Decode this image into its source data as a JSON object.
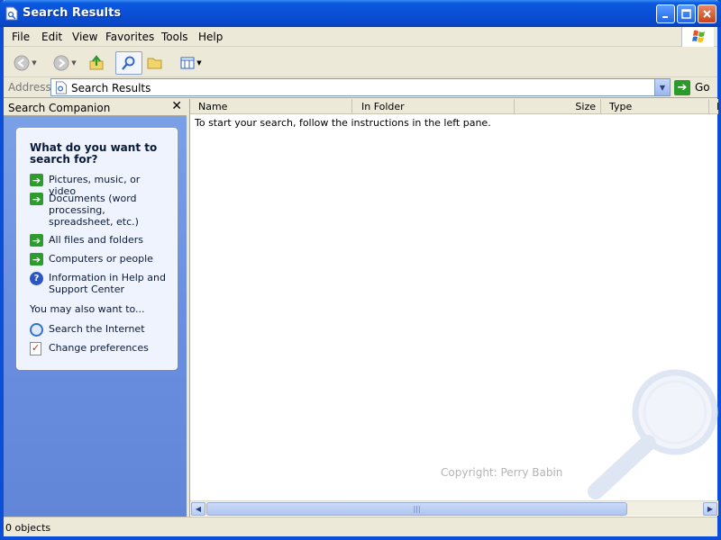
{
  "window": {
    "title": "Search Results"
  },
  "menu": [
    "File",
    "Edit",
    "View",
    "Favorites",
    "Tools",
    "Help"
  ],
  "address": {
    "label": "Address",
    "value": "Search Results",
    "go_label": "Go"
  },
  "search_companion": {
    "title": "Search Companion",
    "close_glyph": "✕",
    "heading": "What do you want to search for?",
    "options": [
      {
        "label": "Pictures, music, or video",
        "icon": "green-arrow-icon"
      },
      {
        "label": "Documents (word processing, spreadsheet, etc.)",
        "icon": "green-arrow-icon"
      },
      {
        "label": "All files and folders",
        "icon": "green-arrow-icon"
      },
      {
        "label": "Computers or people",
        "icon": "green-arrow-icon"
      },
      {
        "label": "Information in Help and Support Center",
        "icon": "help-icon"
      }
    ],
    "also_label": "You may also want to...",
    "extras": [
      {
        "label": "Search the Internet",
        "icon": "search-internet-icon"
      },
      {
        "label": "Change preferences",
        "icon": "preferences-icon"
      }
    ]
  },
  "results": {
    "columns": [
      "Name",
      "In Folder",
      "Size",
      "Type",
      "D"
    ],
    "empty_message": "To start your search, follow the instructions in the left pane.",
    "watermark_text": "Copyright: Perry Babin"
  },
  "status": {
    "text": "0 objects"
  },
  "colors": {
    "title_bar": "#0a4fd6",
    "left_pane": "#6b8fe0",
    "panel_box": "#eef3fd"
  }
}
